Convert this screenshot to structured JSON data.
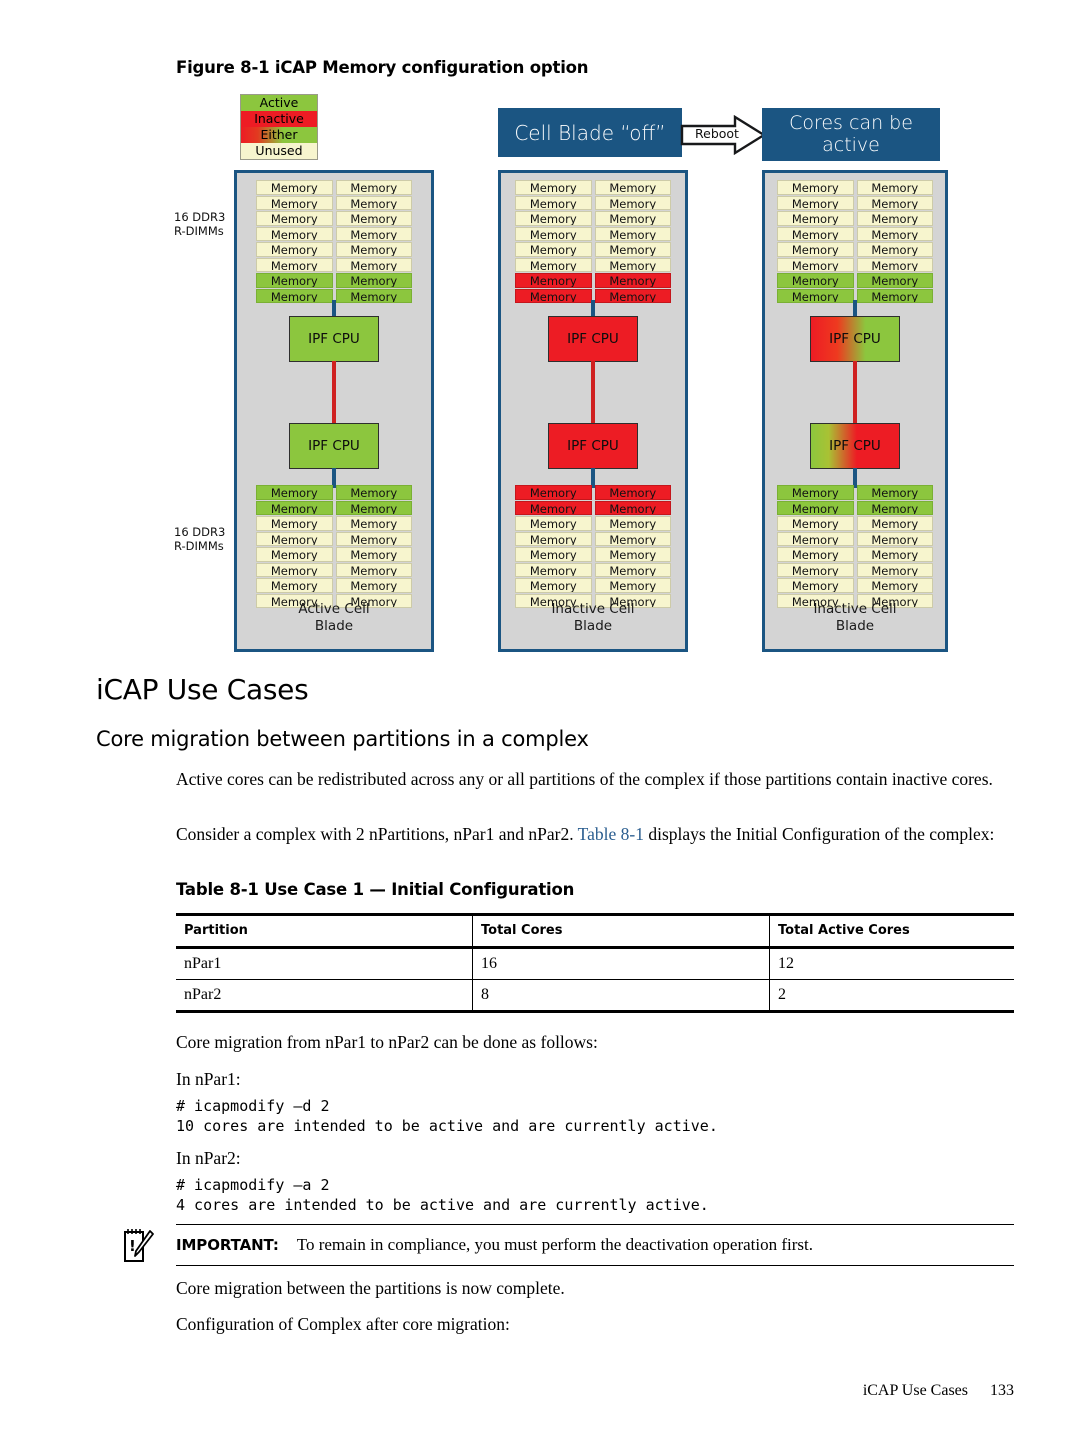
{
  "figure": {
    "caption": "Figure 8-1 iCAP Memory configuration option",
    "legend": [
      {
        "label": "Active",
        "state": "active"
      },
      {
        "label": "Inactive",
        "state": "inactive"
      },
      {
        "label": "Either",
        "state": "either"
      },
      {
        "label": "Unused",
        "state": "unused"
      }
    ],
    "banners": {
      "left": "Cell Blade “off”",
      "arrow_label": "Reboot",
      "right": "Cores can be active"
    },
    "dimm_label_top": "16 DDR3\nR-DIMMs",
    "dimm_label_bottom": "16 DDR3\nR-DIMMs",
    "memory_cell_label": "Memory",
    "cpu_label": "IPF CPU",
    "blades": [
      {
        "name": "blade-active",
        "label": "Active Cell\nBlade",
        "top_memory": [
          "unused",
          "unused",
          "unused",
          "unused",
          "unused",
          "unused",
          "unused",
          "unused",
          "unused",
          "unused",
          "unused",
          "unused",
          "active",
          "active",
          "active",
          "active"
        ],
        "bottom_memory": [
          "active",
          "active",
          "active",
          "active",
          "unused",
          "unused",
          "unused",
          "unused",
          "unused",
          "unused",
          "unused",
          "unused",
          "unused",
          "unused",
          "unused",
          "unused"
        ],
        "cpu_top": "green",
        "cpu_bottom": "green"
      },
      {
        "name": "blade-inactive-1",
        "label": "Inactive Cell\nBlade",
        "top_memory": [
          "unused",
          "unused",
          "unused",
          "unused",
          "unused",
          "unused",
          "unused",
          "unused",
          "unused",
          "unused",
          "unused",
          "unused",
          "inactive",
          "inactive",
          "inactive",
          "inactive"
        ],
        "bottom_memory": [
          "inactive",
          "inactive",
          "inactive",
          "inactive",
          "unused",
          "unused",
          "unused",
          "unused",
          "unused",
          "unused",
          "unused",
          "unused",
          "unused",
          "unused",
          "unused",
          "unused"
        ],
        "cpu_top": "red",
        "cpu_bottom": "red"
      },
      {
        "name": "blade-inactive-2",
        "label": "Inactive Cell\nBlade",
        "top_memory": [
          "unused",
          "unused",
          "unused",
          "unused",
          "unused",
          "unused",
          "unused",
          "unused",
          "unused",
          "unused",
          "unused",
          "unused",
          "active",
          "active",
          "active",
          "active"
        ],
        "bottom_memory": [
          "active",
          "active",
          "active",
          "active",
          "unused",
          "unused",
          "unused",
          "unused",
          "unused",
          "unused",
          "unused",
          "unused",
          "unused",
          "unused",
          "unused",
          "unused"
        ],
        "cpu_top": "gradient-red-green",
        "cpu_bottom": "gradient-green-red"
      }
    ],
    "colors": {
      "active": "#8cc63e",
      "inactive": "#ed1c24",
      "unused": "#f7f5ce",
      "blade_border": "#1b5582",
      "blade_fill": "#d4d4d4",
      "banner": "#1b5582"
    }
  },
  "section": {
    "heading": "iCAP Use Cases",
    "subheading": "Core migration between partitions in a complex",
    "p1": "Active cores can be redistributed across any or all partitions of the complex if those partitions contain inactive cores.",
    "p2_before": "Consider a complex with 2 nPartitions, nPar1 and nPar2. ",
    "p2_link": "Table 8-1",
    "p2_after": " displays the Initial Configuration of the complex:",
    "p3": "Core migration from nPar1 to nPar2 can be done as follows:",
    "p4": "In nPar1:",
    "p5": "In nPar2:",
    "p6": "Core migration between the partitions is now complete.",
    "p7": "Configuration of Complex after core migration:"
  },
  "table": {
    "caption": "Table 8-1 Use Case 1 — Initial Configuration",
    "headers": [
      "Partition",
      "Total Cores",
      "Total Active Cores"
    ],
    "rows": [
      [
        "nPar1",
        "16",
        "12"
      ],
      [
        "nPar2",
        "8",
        "2"
      ]
    ]
  },
  "code": {
    "block1": "# icapmodify –d 2\n10 cores are intended to be active and are currently active.",
    "block2": "# icapmodify –a 2\n4 cores are intended to be active and are currently active."
  },
  "note": {
    "label": "IMPORTANT:",
    "text": "To remain in compliance, you must perform the deactivation operation first."
  },
  "footer": {
    "title": "iCAP Use Cases",
    "page": "133"
  }
}
